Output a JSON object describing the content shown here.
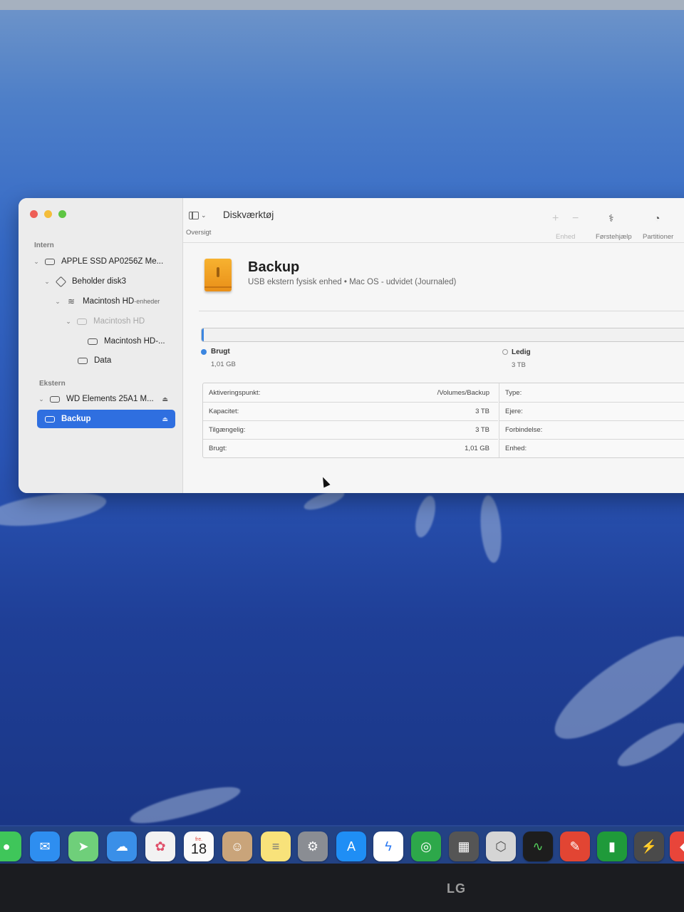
{
  "app": {
    "title": "Diskværktøj",
    "view_label": "Oversigt"
  },
  "toolbar": {
    "add_symbol": "+",
    "remove_symbol": "−",
    "device_label": "Enhed",
    "first_aid_label": "Førstehjælp",
    "partition_label": "Partitioner"
  },
  "sidebar": {
    "internal_label": "Intern",
    "external_label": "Ekstern",
    "items": [
      {
        "label": "APPLE SSD AP0256Z Me..."
      },
      {
        "label": "Beholder disk3"
      },
      {
        "label": "Macintosh HD",
        "suffix": "-enheder"
      },
      {
        "label": "Macintosh HD"
      },
      {
        "label": "Macintosh HD-..."
      },
      {
        "label": "Data"
      },
      {
        "label": "WD Elements 25A1 M..."
      },
      {
        "label": "Backup"
      }
    ]
  },
  "volume": {
    "name": "Backup",
    "description": "USB ekstern fysisk enhed • Mac OS - udvidet (Journaled)",
    "used_fraction": 0.0003
  },
  "usage": {
    "used_label": "Brugt",
    "used_value": "1,01 GB",
    "free_label": "Ledig",
    "free_value": "3 TB",
    "used_color": "#3b86e0"
  },
  "info": {
    "left": [
      {
        "key": "Aktiveringspunkt:",
        "value": "/Volumes/Backup"
      },
      {
        "key": "Kapacitet:",
        "value": "3 TB"
      },
      {
        "key": "Tilgængelig:",
        "value": "3 TB"
      },
      {
        "key": "Brugt:",
        "value": "1,01 GB"
      }
    ],
    "right": [
      {
        "key": "Type:"
      },
      {
        "key": "Ejere:"
      },
      {
        "key": "Forbindelse:"
      },
      {
        "key": "Enhed:"
      }
    ]
  },
  "dock": {
    "calendar_month": "fre.",
    "calendar_day": "18",
    "icons": [
      "messages-icon",
      "mail-icon",
      "maps-icon",
      "weather-icon",
      "photos-icon",
      "calendar-icon",
      "contacts-icon",
      "notes-icon",
      "system-settings-icon",
      "app-store-icon",
      "messenger-icon",
      "find-my-icon",
      "calculator-icon",
      "settings-cube-icon",
      "activity-monitor-icon",
      "pencil-app-icon",
      "numbers-icon",
      "reeder-icon",
      "red-app-icon"
    ]
  },
  "monitor": {
    "brand": "LG"
  }
}
